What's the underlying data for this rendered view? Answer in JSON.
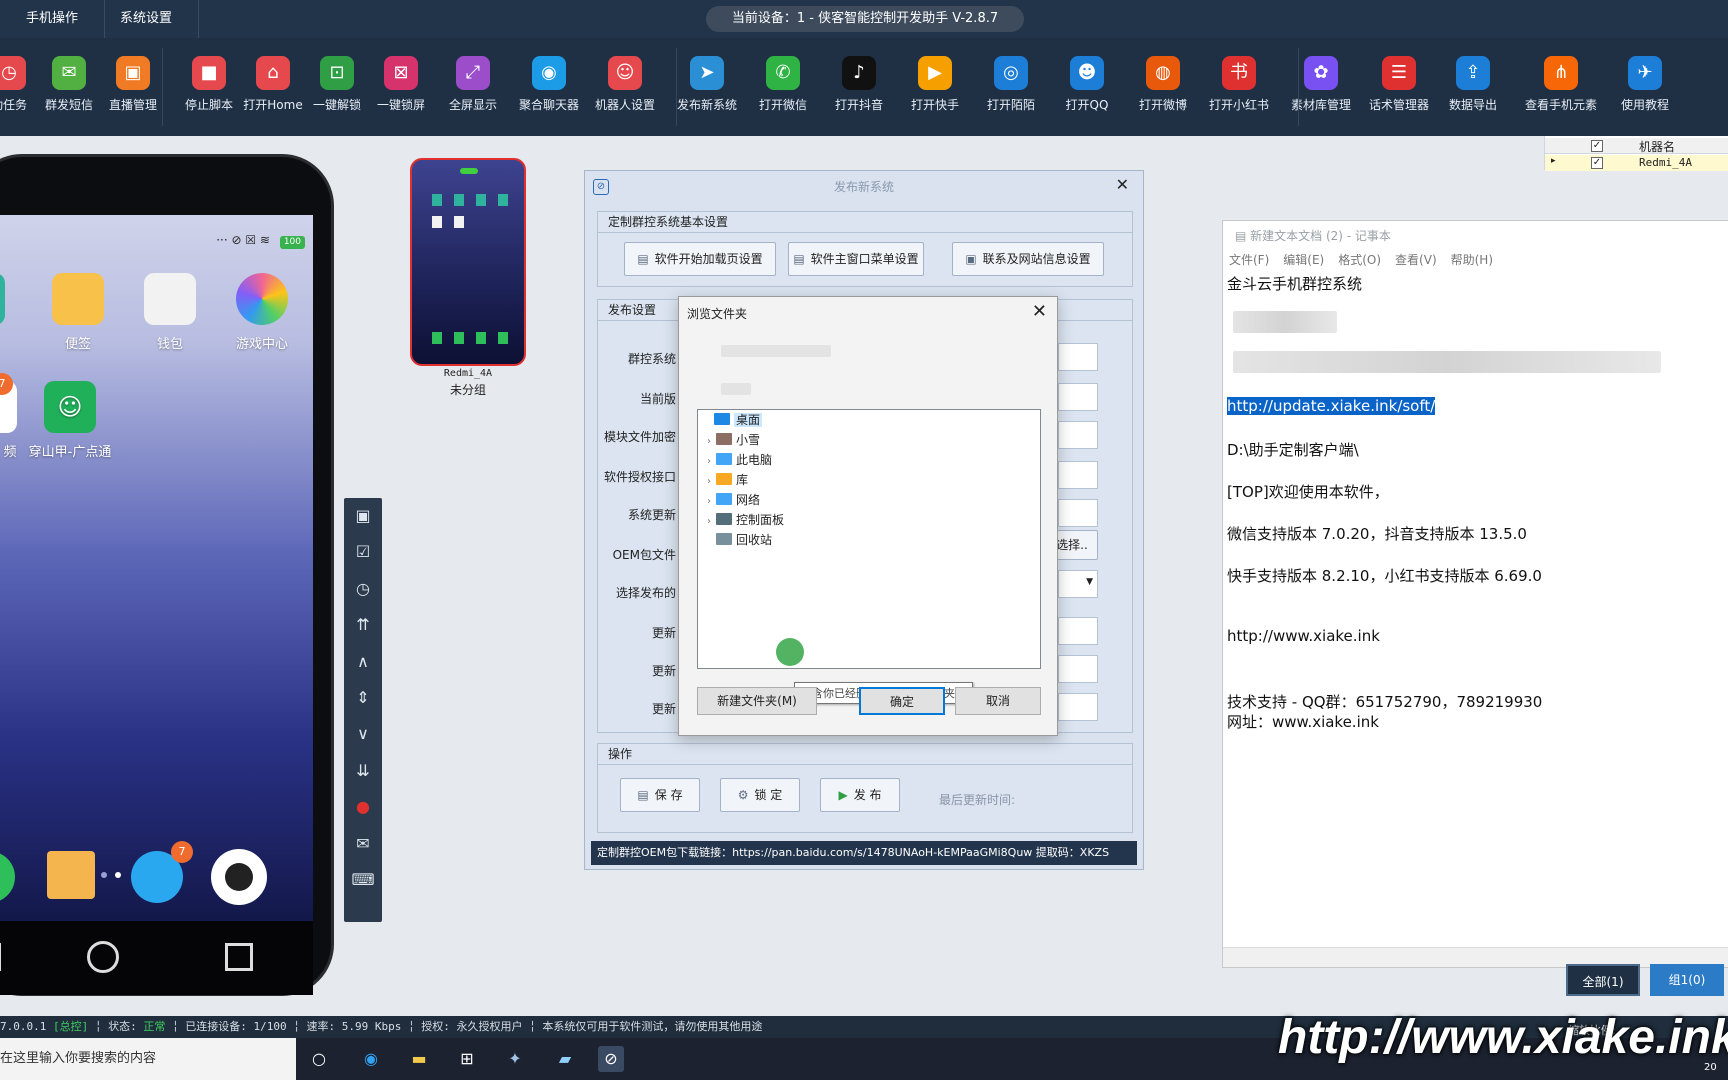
{
  "topbar": {
    "tabs": [
      "手机操作",
      "系统设置"
    ],
    "device_title": "当前设备：1 - 侠客智能控制开发助手 V-2.8.7"
  },
  "toolbar": {
    "items": [
      {
        "label": "动任务",
        "icon": "clock-icon",
        "color": "#e5484d",
        "glyph": "◷"
      },
      {
        "label": "群发短信",
        "icon": "message-icon",
        "color": "#52b043",
        "glyph": "✉"
      },
      {
        "label": "直播管理",
        "icon": "tv-icon",
        "color": "#f07b24",
        "glyph": "▣"
      },
      {
        "label": "停止脚本",
        "icon": "stop-icon",
        "color": "#e5484d",
        "glyph": "■"
      },
      {
        "label": "打开Home",
        "icon": "home-icon",
        "color": "#e5484d",
        "glyph": "⌂"
      },
      {
        "label": "一键解锁",
        "icon": "unlock-icon",
        "color": "#2f9e44",
        "glyph": "⊡"
      },
      {
        "label": "一键锁屏",
        "icon": "lock-icon",
        "color": "#d6336c",
        "glyph": "⊠"
      },
      {
        "label": "全屏显示",
        "icon": "fullscreen-icon",
        "color": "#9b4dca",
        "glyph": "⤢"
      },
      {
        "label": "聚合聊天器",
        "icon": "chat-icon",
        "color": "#1c9be6",
        "glyph": "◉"
      },
      {
        "label": "机器人设置",
        "icon": "robot-icon",
        "color": "#e5484d",
        "glyph": "☺"
      },
      {
        "label": "发布新系统",
        "icon": "paperplane-icon",
        "color": "#2b8fd6",
        "glyph": "➤"
      },
      {
        "label": "打开微信",
        "icon": "wechat-icon",
        "color": "#2fb344",
        "glyph": "✆"
      },
      {
        "label": "打开抖音",
        "icon": "douyin-icon",
        "color": "#111111",
        "glyph": "♪"
      },
      {
        "label": "打开快手",
        "icon": "kuaishou-icon",
        "color": "#f59f00",
        "glyph": "▶"
      },
      {
        "label": "打开陌陌",
        "icon": "momo-icon",
        "color": "#1c7ed6",
        "glyph": "◎"
      },
      {
        "label": "打开QQ",
        "icon": "qq-icon",
        "color": "#1c7ed6",
        "glyph": "☻"
      },
      {
        "label": "打开微博",
        "icon": "weibo-icon",
        "color": "#e8590c",
        "glyph": "◍"
      },
      {
        "label": "打开小红书",
        "icon": "xiaohongshu-icon",
        "color": "#e03131",
        "glyph": "书"
      },
      {
        "label": "素材库管理",
        "icon": "material-icon",
        "color": "#7950f2",
        "glyph": "✿"
      },
      {
        "label": "话术管理器",
        "icon": "script-icon",
        "color": "#e03131",
        "glyph": "☰"
      },
      {
        "label": "数据导出",
        "icon": "export-icon",
        "color": "#1c7ed6",
        "glyph": "⇪"
      },
      {
        "label": "查看手机元素",
        "icon": "share-icon",
        "color": "#f76707",
        "glyph": "⋔"
      },
      {
        "label": "使用教程",
        "icon": "tutorial-icon",
        "color": "#1c7ed6",
        "glyph": "✈"
      }
    ]
  },
  "phone": {
    "apps_row1": [
      {
        "label": "便签",
        "color": "#f8c14a"
      },
      {
        "label": "钱包",
        "color": "#f2f2f2"
      },
      {
        "label": "游戏中心",
        "color": "#f06595"
      }
    ],
    "apps_row2": [
      {
        "label": "频",
        "color": "#ffffff"
      },
      {
        "label": "穿山甲-广点通",
        "color": "#20b05a"
      }
    ],
    "badge_row2": "7",
    "badge_dock": "7",
    "battery": "100"
  },
  "thumbnail": {
    "device_name": "Redmi_4A",
    "group": "未分组"
  },
  "publish_dialog": {
    "title": "发布新系统",
    "group1_title": "定制群控系统基本设置",
    "btn_loading_page": "软件开始加载页设置",
    "btn_main_menu": "软件主窗口菜单设置",
    "btn_contact": "联系及网站信息设置",
    "group2_title": "发布设置",
    "rows": [
      "群控系统",
      "当前版",
      "模块文件加密",
      "软件授权接口",
      "系统更新",
      "OEM包文件",
      "选择发布的",
      "更新",
      "更新",
      "更新"
    ],
    "choose_btn": "选择..",
    "group3_title": "操作",
    "btn_save": "保 存",
    "btn_lock": "锁 定",
    "btn_publish": "发 布",
    "last_update_label": "最后更新时间:",
    "oem_link": "定制群控OEM包下载链接：https://pan.baidu.com/s/1478UNAoH-kEMPaaGMi8Quw 提取码：XKZS"
  },
  "browse_dialog": {
    "title": "浏览文件夹",
    "tree": [
      {
        "label": "桌面",
        "icon": "desktop-icon",
        "color": "#1e88e5",
        "expand": ""
      },
      {
        "label": "小雪",
        "icon": "user-icon",
        "color": "#8d6e63",
        "expand": "›"
      },
      {
        "label": "此电脑",
        "icon": "computer-icon",
        "color": "#42a5f5",
        "expand": "›"
      },
      {
        "label": "库",
        "icon": "library-icon",
        "color": "#f9a825",
        "expand": "›"
      },
      {
        "label": "网络",
        "icon": "network-icon",
        "color": "#42a5f5",
        "expand": "›"
      },
      {
        "label": "控制面板",
        "icon": "control-panel-icon",
        "color": "#546e7a",
        "expand": "›"
      },
      {
        "label": "回收站",
        "icon": "recycle-bin-icon",
        "color": "#78909c",
        "expand": ""
      }
    ],
    "tooltip": "包含你已经删除的文件和文件夹。",
    "btn_new_folder": "新建文件夹(M)",
    "btn_ok": "确定",
    "btn_cancel": "取消"
  },
  "notepad": {
    "title": "新建文本文档 (2) - 记事本",
    "menu": [
      "文件(F)",
      "编辑(E)",
      "格式(O)",
      "查看(V)",
      "帮助(H)"
    ],
    "lines": {
      "l1": "金斗云手机群控系统",
      "url_selected": "http://update.xiake.ink/soft/",
      "path": "D:\\助手定制客户端\\",
      "welcome": "[TOP]欢迎使用本软件，",
      "versions1": "微信支持版本 7.0.20，抖音支持版本 13.5.0",
      "versions2": "快手支持版本 8.2.10，小红书支持版本 6.69.0",
      "site": "http://www.xiake.ink",
      "support": "技术支持 - QQ群：651752790，789219930",
      "site2": "网址：www.xiake.ink"
    }
  },
  "right_panel": {
    "column_header": "机器名",
    "row_name": "Redmi_4A",
    "btn_all": "全部(1)",
    "btn_group1": "组1(0)",
    "scale_label": "缩放比例:"
  },
  "status_bar": {
    "ip": "7.0.0.1",
    "mode": "[总控]",
    "state_label": "状态:",
    "state_value": "正常",
    "connected": "已连接设备: 1/100",
    "speed": "速率: 5.99 Kbps",
    "license": "授权: 永久授权用户",
    "notice": "本系统仅可用于软件测试，请勿使用其他用途"
  },
  "taskbar": {
    "search_placeholder": "在这里输入你要搜索的内容",
    "watermark": "http://www.xiake.ink",
    "tray_text": "20"
  }
}
